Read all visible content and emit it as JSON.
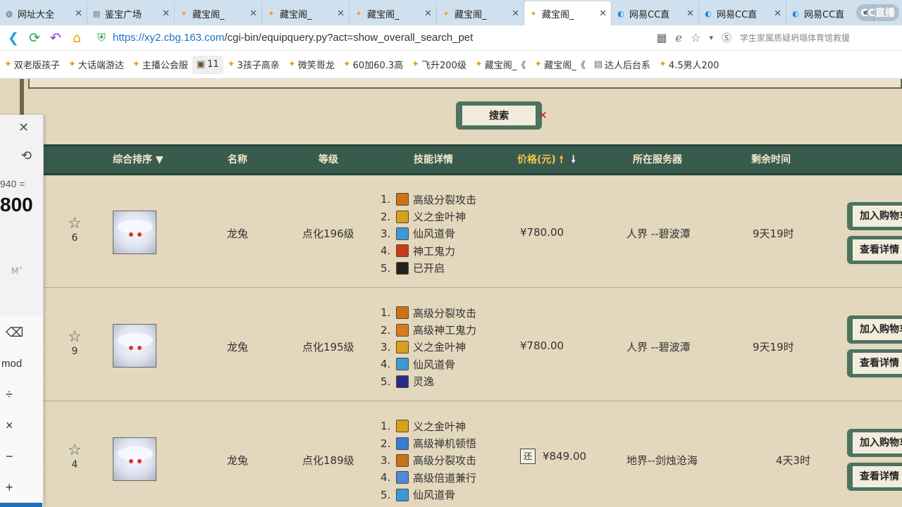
{
  "browser": {
    "tabs": [
      {
        "label": "网址大全",
        "icon": "globe-icon",
        "active": false
      },
      {
        "label": "鉴宝广场",
        "icon": "page-icon",
        "active": false
      },
      {
        "label": "藏宝阁_",
        "icon": "cbg-icon",
        "active": false
      },
      {
        "label": "藏宝阁_",
        "icon": "cbg-icon",
        "active": false
      },
      {
        "label": "藏宝阁_",
        "icon": "cbg-icon",
        "active": false
      },
      {
        "label": "藏宝阁_",
        "icon": "cbg-icon",
        "active": false
      },
      {
        "label": "藏宝阁_",
        "icon": "cbg-icon",
        "active": true
      },
      {
        "label": "网易CC直",
        "icon": "cc-icon",
        "active": false
      },
      {
        "label": "网易CC直",
        "icon": "cc-icon",
        "active": false
      },
      {
        "label": "网易CC直",
        "icon": "cc-icon",
        "active": false
      }
    ],
    "cc_logo": "CC直播",
    "url_host": "https://xy2.cbg.163.com",
    "url_path": "/cgi-bin/equipquery.py?act=show_overall_search_pet",
    "search_hint": "学生家属质疑坍塌体育馆救援",
    "bookmarks": [
      {
        "label": "双老版孩子",
        "icon": "bookmark-icon"
      },
      {
        "label": "大话端游达",
        "icon": "bookmark-icon"
      },
      {
        "label": "主播公会服",
        "icon": "bookmark-icon"
      },
      {
        "label": "11",
        "icon": "game-icon"
      },
      {
        "label": "3孩子高亲",
        "icon": "bookmark-icon"
      },
      {
        "label": "微笑哥龙",
        "icon": "bookmark-icon"
      },
      {
        "label": "60加60.3高",
        "icon": "bookmark-icon"
      },
      {
        "label": "飞升200级",
        "icon": "bookmark-icon"
      },
      {
        "label": "藏宝阁_《",
        "icon": "bookmark-icon"
      },
      {
        "label": "藏宝阁_《",
        "icon": "bookmark-icon"
      },
      {
        "label": "达人后台系",
        "icon": "page-icon"
      },
      {
        "label": "4.5男人200",
        "icon": "bookmark-icon"
      }
    ]
  },
  "search_button": "搜索",
  "table": {
    "headers": {
      "sort": "综合排序",
      "name": "名称",
      "level": "等级",
      "skills": "技能详情",
      "price": "价格(元)",
      "server": "所在服务器",
      "time": "剩余时间"
    },
    "rows": [
      {
        "fav": "6",
        "name": "龙兔",
        "level": "点化196级",
        "skills": [
          "高级分裂攻击",
          "义之金叶神",
          "仙风道骨",
          "神工鬼力",
          "已开启"
        ],
        "skill_nums": [
          "1.",
          "2.",
          "3.",
          "4.",
          "5."
        ],
        "price": "¥780.00",
        "price_tag": "",
        "server": "人界 --碧波潭",
        "time": "9天19时",
        "btn_cart": "加入购物车",
        "btn_view": "查看详情"
      },
      {
        "fav": "9",
        "name": "龙兔",
        "level": "点化195级",
        "skills": [
          "高级分裂攻击",
          "高级神工鬼力",
          "义之金叶神",
          "仙风道骨",
          "灵逸"
        ],
        "skill_nums": [
          "1.",
          "2.",
          "3.",
          "4.",
          "5."
        ],
        "price": "¥780.00",
        "price_tag": "",
        "server": "人界 --碧波潭",
        "time": "9天19时",
        "btn_cart": "加入购物车",
        "btn_view": "查看详情"
      },
      {
        "fav": "4",
        "name": "龙兔",
        "level": "点化189级",
        "skills": [
          "义之金叶神",
          "高级禅机顿悟",
          "高级分裂攻击",
          "高级倍道兼行",
          "仙风道骨"
        ],
        "skill_nums": [
          "1.",
          "2.",
          "3.",
          "4.",
          "5."
        ],
        "price": "¥849.00",
        "price_tag": "还",
        "server": "地界--剑烛沧海",
        "time": "4天3时",
        "btn_cart": "加入购物车",
        "btn_view": "查看详情"
      }
    ]
  },
  "calculator": {
    "expr": "940 =",
    "value": "800",
    "mem": "M˅",
    "keys": [
      "⌫",
      "mod",
      "÷",
      "×",
      "−",
      "+"
    ]
  }
}
